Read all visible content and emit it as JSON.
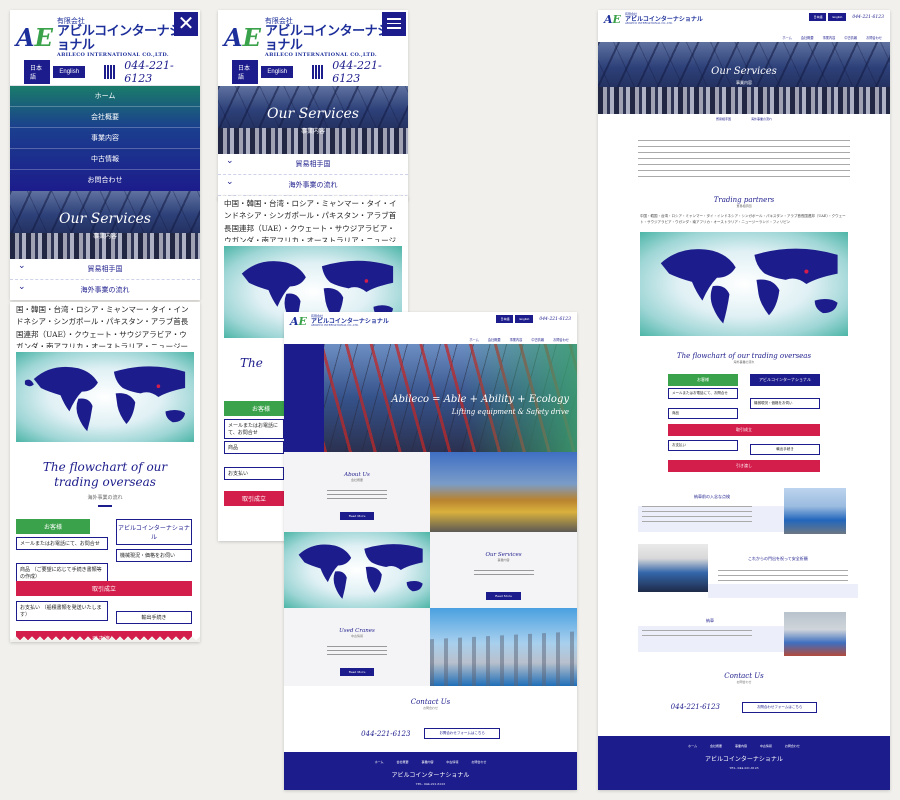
{
  "brand": {
    "company_type": "有限会社",
    "name_jp": "アビルコインターナショナル",
    "name_en": "ABILECO INTERNATIONAL CO.,LTD.",
    "mark": "AE"
  },
  "header": {
    "lang_jp": "日本語",
    "lang_en": "English",
    "tel_label": "TEL",
    "tel": "044-221-6123"
  },
  "mobile_menu": {
    "items": [
      "ホーム",
      "会社概要",
      "事業内容",
      "中古情報",
      "お問合わせ"
    ]
  },
  "services_hero": {
    "title": "Our Services",
    "subtitle": "事業内容"
  },
  "accordion": {
    "items": [
      "貿易相手国",
      "海外事業の流れ"
    ]
  },
  "partners": {
    "countries_text": "中国・韓国・台湾・ロシア・ミャンマー・タイ・インドネシア・シンガポール・パキスタン・アラブ首長国連邦（UAE）・クウェート・サウジアラビア・ウガンダ・南アフリカ・オーストラリア・ニュージーランド・フィリピン",
    "countries_text_cut": "国・韓国・台湾・ロシア・ミャンマー・タイ・インドネシア・シンガポール・パキスタン・アラブ首長国連邦（UAE）・クウェート・サウジアラビア・ウガンダ・南アフリカ・オーストラリア・ニュージーランド・フィリピン",
    "title": "Trading partners",
    "subtitle": "貿易相手国"
  },
  "flowchart": {
    "title": "The flowchart of our trading overseas",
    "subtitle": "海外事業の流れ",
    "client_label": "お客様",
    "company_label": "アビルコインターナショナル",
    "step1": "メールまたはお電話にて、お問合せ",
    "step2": "機械現況・価格をお伺い",
    "step3": "商品",
    "step3_note": "（ご要望に応じて手続き書類等の作成）",
    "contract": "取引成立",
    "step4": "お支払い",
    "step4_note": "（船積書類を発送いたします）",
    "step5": "輸出手続き",
    "handover": "引き渡し"
  },
  "home": {
    "nav": [
      "ホーム",
      "会社概要",
      "事業内容",
      "中古情報",
      "お問合わせ"
    ],
    "hero_title": "Abileco = Able + Ability + Ecology",
    "hero_sub": "Lifting equipment & Safety drive",
    "about_title": "About Us",
    "about_sub": "会社概要",
    "services_title": "Our Services",
    "services_sub": "事業内容",
    "used_title": "Used Cranes",
    "used_sub": "中古情報",
    "read_more": "Read More",
    "contact_title": "Contact Us",
    "contact_sub": "お問合わせ",
    "contact_form_btn": "お問合わせフォームはこちら"
  },
  "desktop_services": {
    "sections": [
      {
        "title": "納車前の入念な点検"
      },
      {
        "title": "これからの門出を祝って安全祈願"
      },
      {
        "title": "納車"
      }
    ]
  },
  "footer": {
    "nav": [
      "ホーム",
      "会社概要",
      "事業内容",
      "中古情報",
      "お問合わせ"
    ],
    "tel_line": "TEL. 044-221-6123"
  },
  "colors": {
    "navy": "#1c1c8c",
    "green": "#3aa24a",
    "red": "#d31d4b",
    "bg": "#f1f0ec"
  }
}
